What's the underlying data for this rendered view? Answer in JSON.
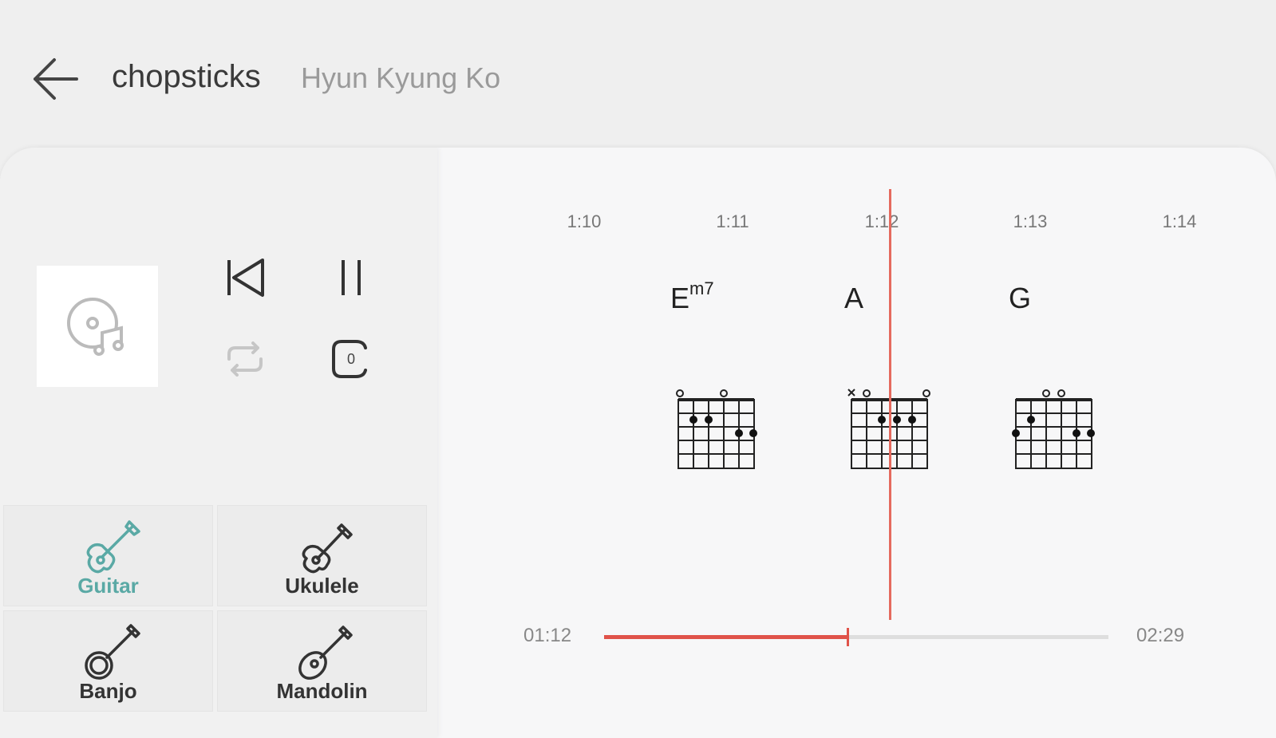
{
  "header": {
    "title": "chopsticks",
    "artist": "Hyun Kyung Ko"
  },
  "player": {
    "capo": "0"
  },
  "instruments": [
    {
      "label": "Guitar",
      "active": true
    },
    {
      "label": "Ukulele",
      "active": false
    },
    {
      "label": "Banjo",
      "active": false
    },
    {
      "label": "Mandolin",
      "active": false
    }
  ],
  "timeline": {
    "times": [
      "1:10",
      "1:11",
      "1:12",
      "1:13",
      "1:14"
    ]
  },
  "chords": [
    {
      "root": "E",
      "suffix": "m7"
    },
    {
      "root": "A",
      "suffix": ""
    },
    {
      "root": "G",
      "suffix": ""
    }
  ],
  "progress": {
    "current": "01:12",
    "total": "02:29",
    "fraction": 0.483
  },
  "colors": {
    "accent": "#e0534a",
    "active": "#5aa9a5"
  }
}
